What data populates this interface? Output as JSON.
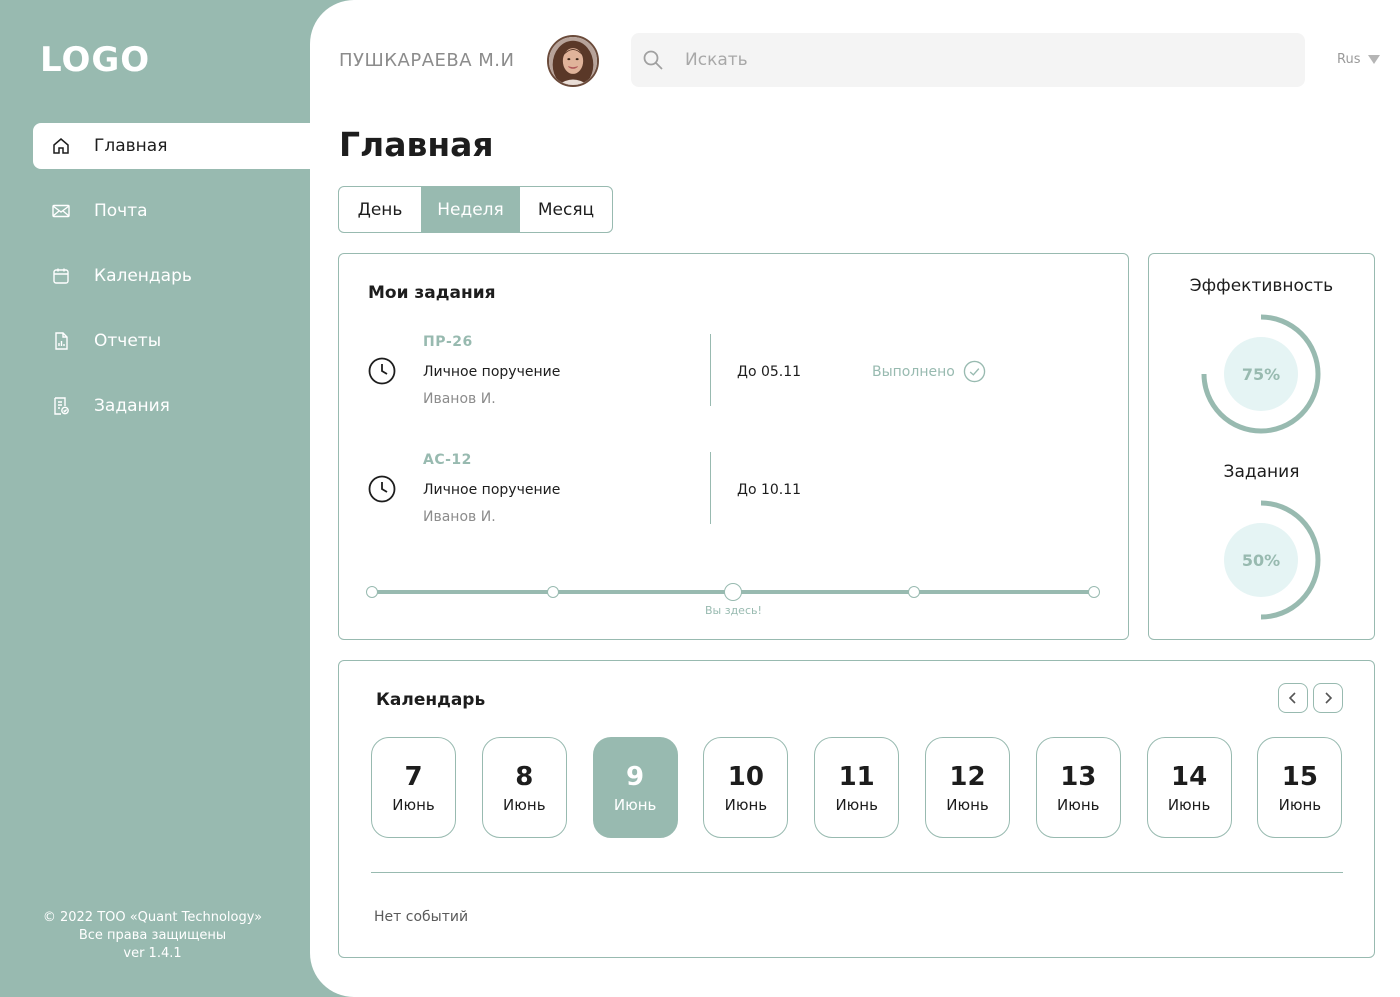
{
  "app": {
    "logo": "LOGO"
  },
  "sidebar": {
    "items": [
      {
        "label": "Главная",
        "icon": "home-icon",
        "active": true
      },
      {
        "label": "Почта",
        "icon": "mail-icon",
        "active": false
      },
      {
        "label": "Календарь",
        "icon": "calendar-icon",
        "active": false
      },
      {
        "label": "Отчеты",
        "icon": "report-icon",
        "active": false
      },
      {
        "label": "Задания",
        "icon": "task-icon",
        "active": false
      }
    ],
    "copyright": [
      "© 2022 ТОО «Quant Technology»",
      "Все права защищены",
      "ver 1.4.1"
    ]
  },
  "header": {
    "user_name": "ПУШКАРАЕВА М.И",
    "search": {
      "placeholder": "Искать",
      "value": ""
    },
    "language": "Rus"
  },
  "page": {
    "title": "Главная",
    "tabs": [
      {
        "label": "День",
        "active": false
      },
      {
        "label": "Неделя",
        "active": true
      },
      {
        "label": "Месяц",
        "active": false
      }
    ]
  },
  "tasks": {
    "title": "Мои задания",
    "items": [
      {
        "code": "ПР-26",
        "type": "Личное поручение",
        "person": "Иванов И.",
        "due": "До 05.11",
        "status": "Выполнено"
      },
      {
        "code": "АС-12",
        "type": "Личное поручение",
        "person": "Иванов И.",
        "due": "До 10.11",
        "status": ""
      }
    ],
    "progress": {
      "steps": 5,
      "current_step": 3,
      "current_label": "Вы здесь!"
    }
  },
  "efficiency": {
    "title": "Эффективность",
    "efficiency_percent": 75,
    "efficiency_label": "75%",
    "tasks_title": "Задания",
    "tasks_percent": 50,
    "tasks_label": "50%"
  },
  "calendar": {
    "title": "Календарь",
    "days": [
      {
        "num": "7",
        "month": "Июнь",
        "active": false
      },
      {
        "num": "8",
        "month": "Июнь",
        "active": false
      },
      {
        "num": "9",
        "month": "Июнь",
        "active": true
      },
      {
        "num": "10",
        "month": "Июнь",
        "active": false
      },
      {
        "num": "11",
        "month": "Июнь",
        "active": false
      },
      {
        "num": "12",
        "month": "Июнь",
        "active": false
      },
      {
        "num": "13",
        "month": "Июнь",
        "active": false
      },
      {
        "num": "14",
        "month": "Июнь",
        "active": false
      },
      {
        "num": "15",
        "month": "Июнь",
        "active": false
      }
    ],
    "no_events": "Нет событий"
  },
  "colors": {
    "accent": "#98bab0",
    "ring_fill": "#e5f4f4",
    "text": "#1d1d1d",
    "muted": "#8c8c8c"
  }
}
